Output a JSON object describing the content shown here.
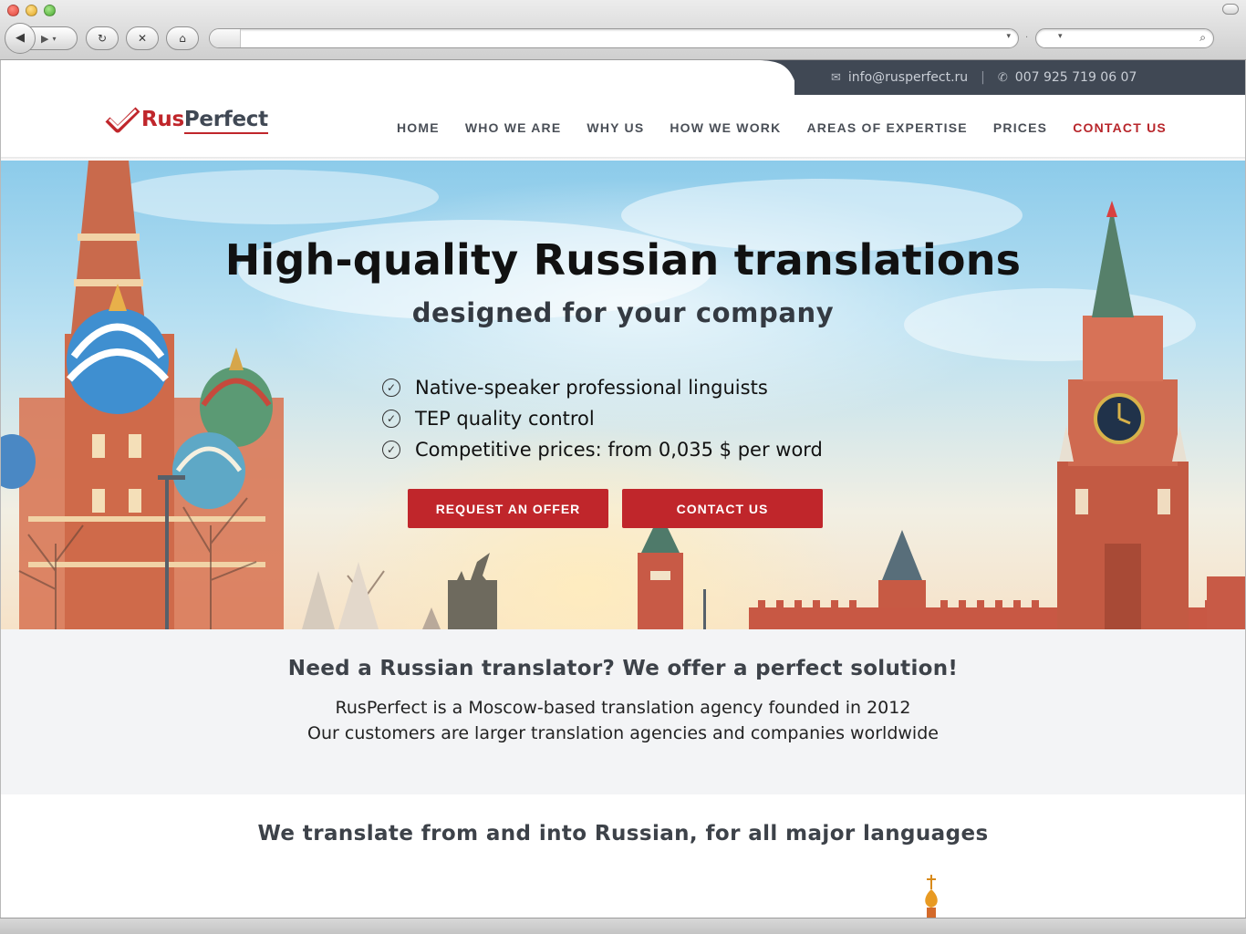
{
  "browser": {
    "buttons": {
      "back": "◀",
      "forward": "▶",
      "dropdown": "▾",
      "reload": "↻",
      "stop": "✕",
      "home": "⌂",
      "search": "⌕"
    }
  },
  "topbar": {
    "email": "info@rusperfect.ru",
    "separator": "|",
    "phone": "007 925 719 06 07",
    "email_icon": "envelope-icon",
    "phone_icon": "phone-icon"
  },
  "logo": {
    "part1": "Rus",
    "part2": "Perfect"
  },
  "nav": {
    "items": [
      {
        "label": "HOME"
      },
      {
        "label": "WHO WE ARE"
      },
      {
        "label": "WHY US"
      },
      {
        "label": "HOW WE WORK"
      },
      {
        "label": "AREAS OF EXPERTISE"
      },
      {
        "label": "PRICES"
      },
      {
        "label": "CONTACT US"
      }
    ],
    "active_index": 6
  },
  "hero": {
    "title": "High-quality Russian translations",
    "subtitle": "designed for your company",
    "features": [
      "Native-speaker professional linguists",
      "TEP quality control",
      "Competitive prices: from 0,035 $ per word"
    ],
    "check_glyph": "✓",
    "buttons": {
      "offer": "REQUEST AN OFFER",
      "contact": "CONTACT US"
    }
  },
  "intro": {
    "heading": "Need a Russian translator? We offer a perfect solution!",
    "line1": "RusPerfect is a Moscow-based translation agency founded in 2012",
    "line2": "Our customers are larger translation agencies and companies worldwide"
  },
  "languages": {
    "heading": "We translate from and into Russian, for all major languages"
  },
  "colors": {
    "brand_red": "#c0262b",
    "dark_slate": "#404854",
    "light_gray": "#f3f4f6"
  }
}
